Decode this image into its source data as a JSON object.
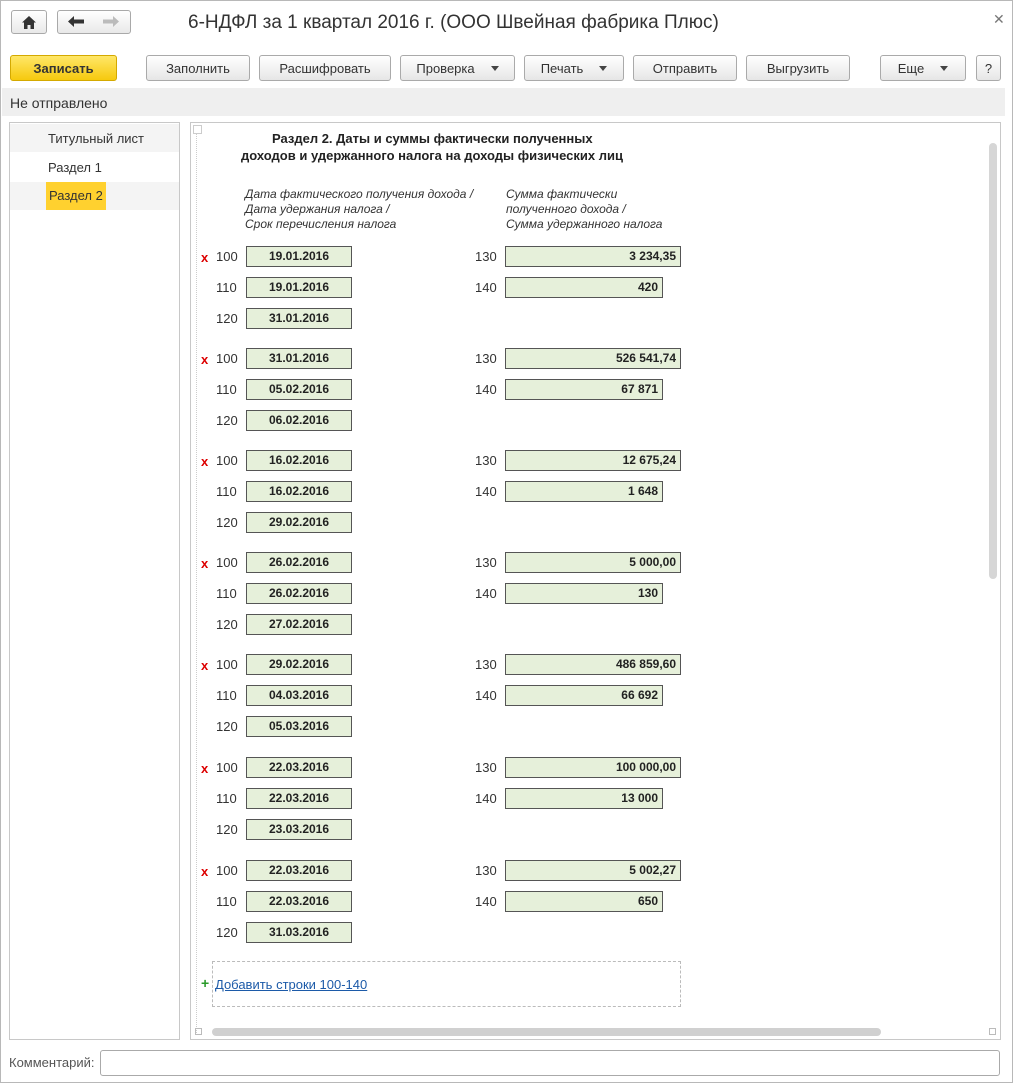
{
  "window": {
    "title": "6-НДФЛ за 1 квартал 2016 г. (ООО Швейная фабрика Плюс)"
  },
  "icons": {
    "home": "home-icon",
    "back": "arrow-left-icon",
    "forward": "arrow-right-icon",
    "close": "close-icon"
  },
  "toolbar": {
    "save": "Записать",
    "fill": "Заполнить",
    "decode": "Расшифровать",
    "check": "Проверка",
    "print": "Печать",
    "send": "Отправить",
    "export": "Выгрузить",
    "more": "Еще",
    "help": "?"
  },
  "status": "Не отправлено",
  "sidebar": {
    "items": [
      {
        "label": "Титульный лист"
      },
      {
        "label": "Раздел 1"
      },
      {
        "label": "Раздел 2"
      }
    ],
    "selected": 2
  },
  "section": {
    "heading_line1": "Раздел 2.  Даты и суммы фактически полученных",
    "heading_line2": "доходов и удержанного налога на доходы физических лиц",
    "col1_line1": "Дата фактического получения дохода /",
    "col1_line2": "Дата удержания налога /",
    "col1_line3": "Срок перечисления налога",
    "col2_line1": "Сумма фактически",
    "col2_line2": "полученного дохода /",
    "col2_line3": "Сумма удержанного налога",
    "delete_mark": "x",
    "codes": {
      "c100": "100",
      "c110": "110",
      "c120": "120",
      "c130": "130",
      "c140": "140"
    },
    "blocks": [
      {
        "d100": "19.01.2016",
        "d110": "19.01.2016",
        "d120": "31.01.2016",
        "s130": "3 234,35",
        "s140": "420"
      },
      {
        "d100": "31.01.2016",
        "d110": "05.02.2016",
        "d120": "06.02.2016",
        "s130": "526 541,74",
        "s140": "67 871"
      },
      {
        "d100": "16.02.2016",
        "d110": "16.02.2016",
        "d120": "29.02.2016",
        "s130": "12 675,24",
        "s140": "1 648"
      },
      {
        "d100": "26.02.2016",
        "d110": "26.02.2016",
        "d120": "27.02.2016",
        "s130": "5 000,00",
        "s140": "130"
      },
      {
        "d100": "29.02.2016",
        "d110": "04.03.2016",
        "d120": "05.03.2016",
        "s130": "486 859,60",
        "s140": "66 692"
      },
      {
        "d100": "22.03.2016",
        "d110": "22.03.2016",
        "d120": "23.03.2016",
        "s130": "100 000,00",
        "s140": "13 000"
      },
      {
        "d100": "22.03.2016",
        "d110": "22.03.2016",
        "d120": "31.03.2016",
        "s130": "5 002,27",
        "s140": "650"
      }
    ],
    "add_rows": "Добавить строки 100-140"
  },
  "comment": {
    "label": "Комментарий:",
    "value": ""
  }
}
